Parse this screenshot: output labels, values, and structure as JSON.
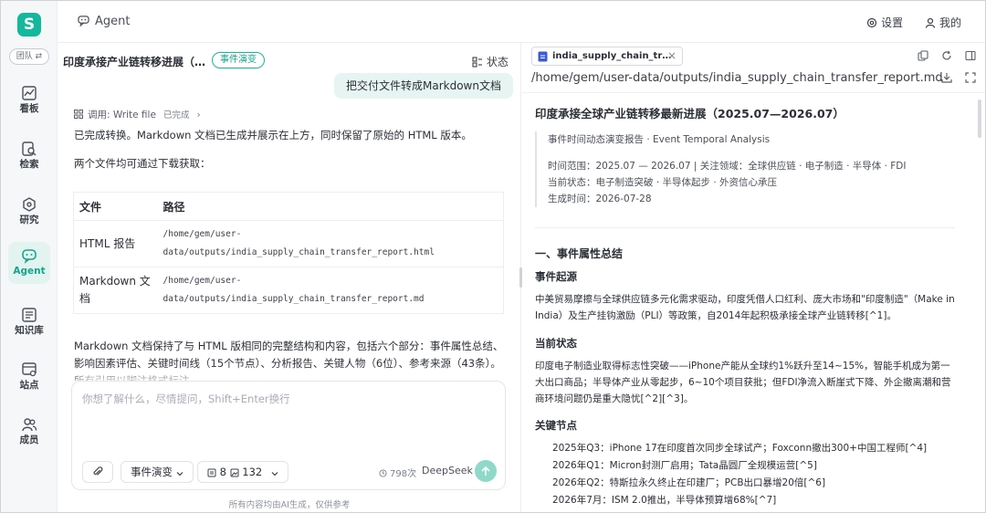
{
  "app": {
    "logo_icon": "app-logo-icon",
    "brand_color": "#14b89c",
    "team_label": "团队 ⇄"
  },
  "nav": [
    {
      "label": "看板",
      "icon": "dashboard-chart-icon"
    },
    {
      "label": "检索",
      "icon": "document-search-icon"
    },
    {
      "label": "研究",
      "icon": "research-network-icon"
    },
    {
      "label": "Agent",
      "icon": "agent-chat-icon",
      "active": true
    },
    {
      "label": "知识库",
      "icon": "knowledge-base-icon"
    },
    {
      "label": "站点",
      "icon": "site-icon"
    },
    {
      "label": "成员",
      "icon": "members-icon"
    }
  ],
  "header": {
    "title": "Agent",
    "settings": "设置",
    "mine": "我的"
  },
  "chat": {
    "title": "印度承接产业链转移进展（…",
    "badge": "事件演变",
    "status": "状态",
    "user_message": "把交付文件转成Markdown文档",
    "tool_call": "调用: Write file",
    "tool_status": "已完成",
    "reply_1": "已完成转换。Markdown 文档已生成并展示在上方，同时保留了原始的 HTML 版本。",
    "reply_2": "两个文件均可通过下载获取：",
    "table": {
      "headers": [
        "文件",
        "路径"
      ],
      "rows": [
        {
          "name": "HTML 报告",
          "path_1": "/home/gem/user-",
          "path_2": "data/outputs/india_supply_chain_transfer_report.html"
        },
        {
          "name": "Markdown 文档",
          "path_1": "/home/gem/user-",
          "path_2": "data/outputs/india_supply_chain_transfer_report.md"
        }
      ]
    },
    "reply_3": "Markdown 文档保持了与 HTML 版相同的完整结构和内容，包括六个部分：事件属性总结、影响因素评估、关键时间线（15个节点）、分析报告、关键人物（6位）、参考来源（43条）。所有引用以脚注格式标注。"
  },
  "composer": {
    "placeholder": "你想了解什么，尽情提问，Shift+Enter换行",
    "mode": "事件演变",
    "count_a": "8",
    "count_b": "132",
    "usage": "798次",
    "model": "DeepSeek",
    "disclaimer": "所有内容均由AI生成，仅供参考"
  },
  "doc": {
    "tab_name": "india_supply_chain_tr…",
    "path": "/home/gem/user-data/outputs/india_supply_chain_transfer_report.md",
    "h1": "印度承接全球产业链转移最新进展（2025.07—2026.07）",
    "meta_line": "事件时间动态演变报告 · Event Temporal Analysis",
    "range": "时间范围：2025.07 — 2026.07 | 关注领域：全球供应链 · 电子制造 · 半导体 · FDI",
    "state": "当前状态：电子制造突破 · 半导体起步 · 外资信心承压",
    "generated": "生成时间：2026-07-28",
    "sec1": "一、事件属性总结",
    "origin_h": "事件起源",
    "origin_p": "中美贸易摩擦与全球供应链多元化需求驱动，印度凭借人口红利、庞大市场和\"印度制造\"（Make in India）及生产挂钩激励（PLI）等政策，自2014年起积极承接全球产业链转移[^1]。",
    "current_h": "当前状态",
    "current_p": "印度电子制造业取得标志性突破——iPhone产能从全球约1%跃升至14~15%，智能手机成为第一大出口商品；半导体产业从零起步，6~10个项目获批；但FDI净流入断崖式下降、外企撤离潮和营商环境问题仍是重大隐忧[^2][^3]。",
    "nodes_h": "关键节点",
    "nodes": [
      "2025年Q3：iPhone 17在印度首次同步全球试产；Foxconn撤出300+中国工程师[^4]",
      "2026年Q1：Micron封测厂启用；Tata晶圆厂全规模运营[^5]",
      "2026年Q2：特斯拉永久终止在印建厂；PCB出口暴增20倍[^6]",
      "2026年7月：ISM 2.0推出，半导体预算增68%[^7]"
    ]
  }
}
